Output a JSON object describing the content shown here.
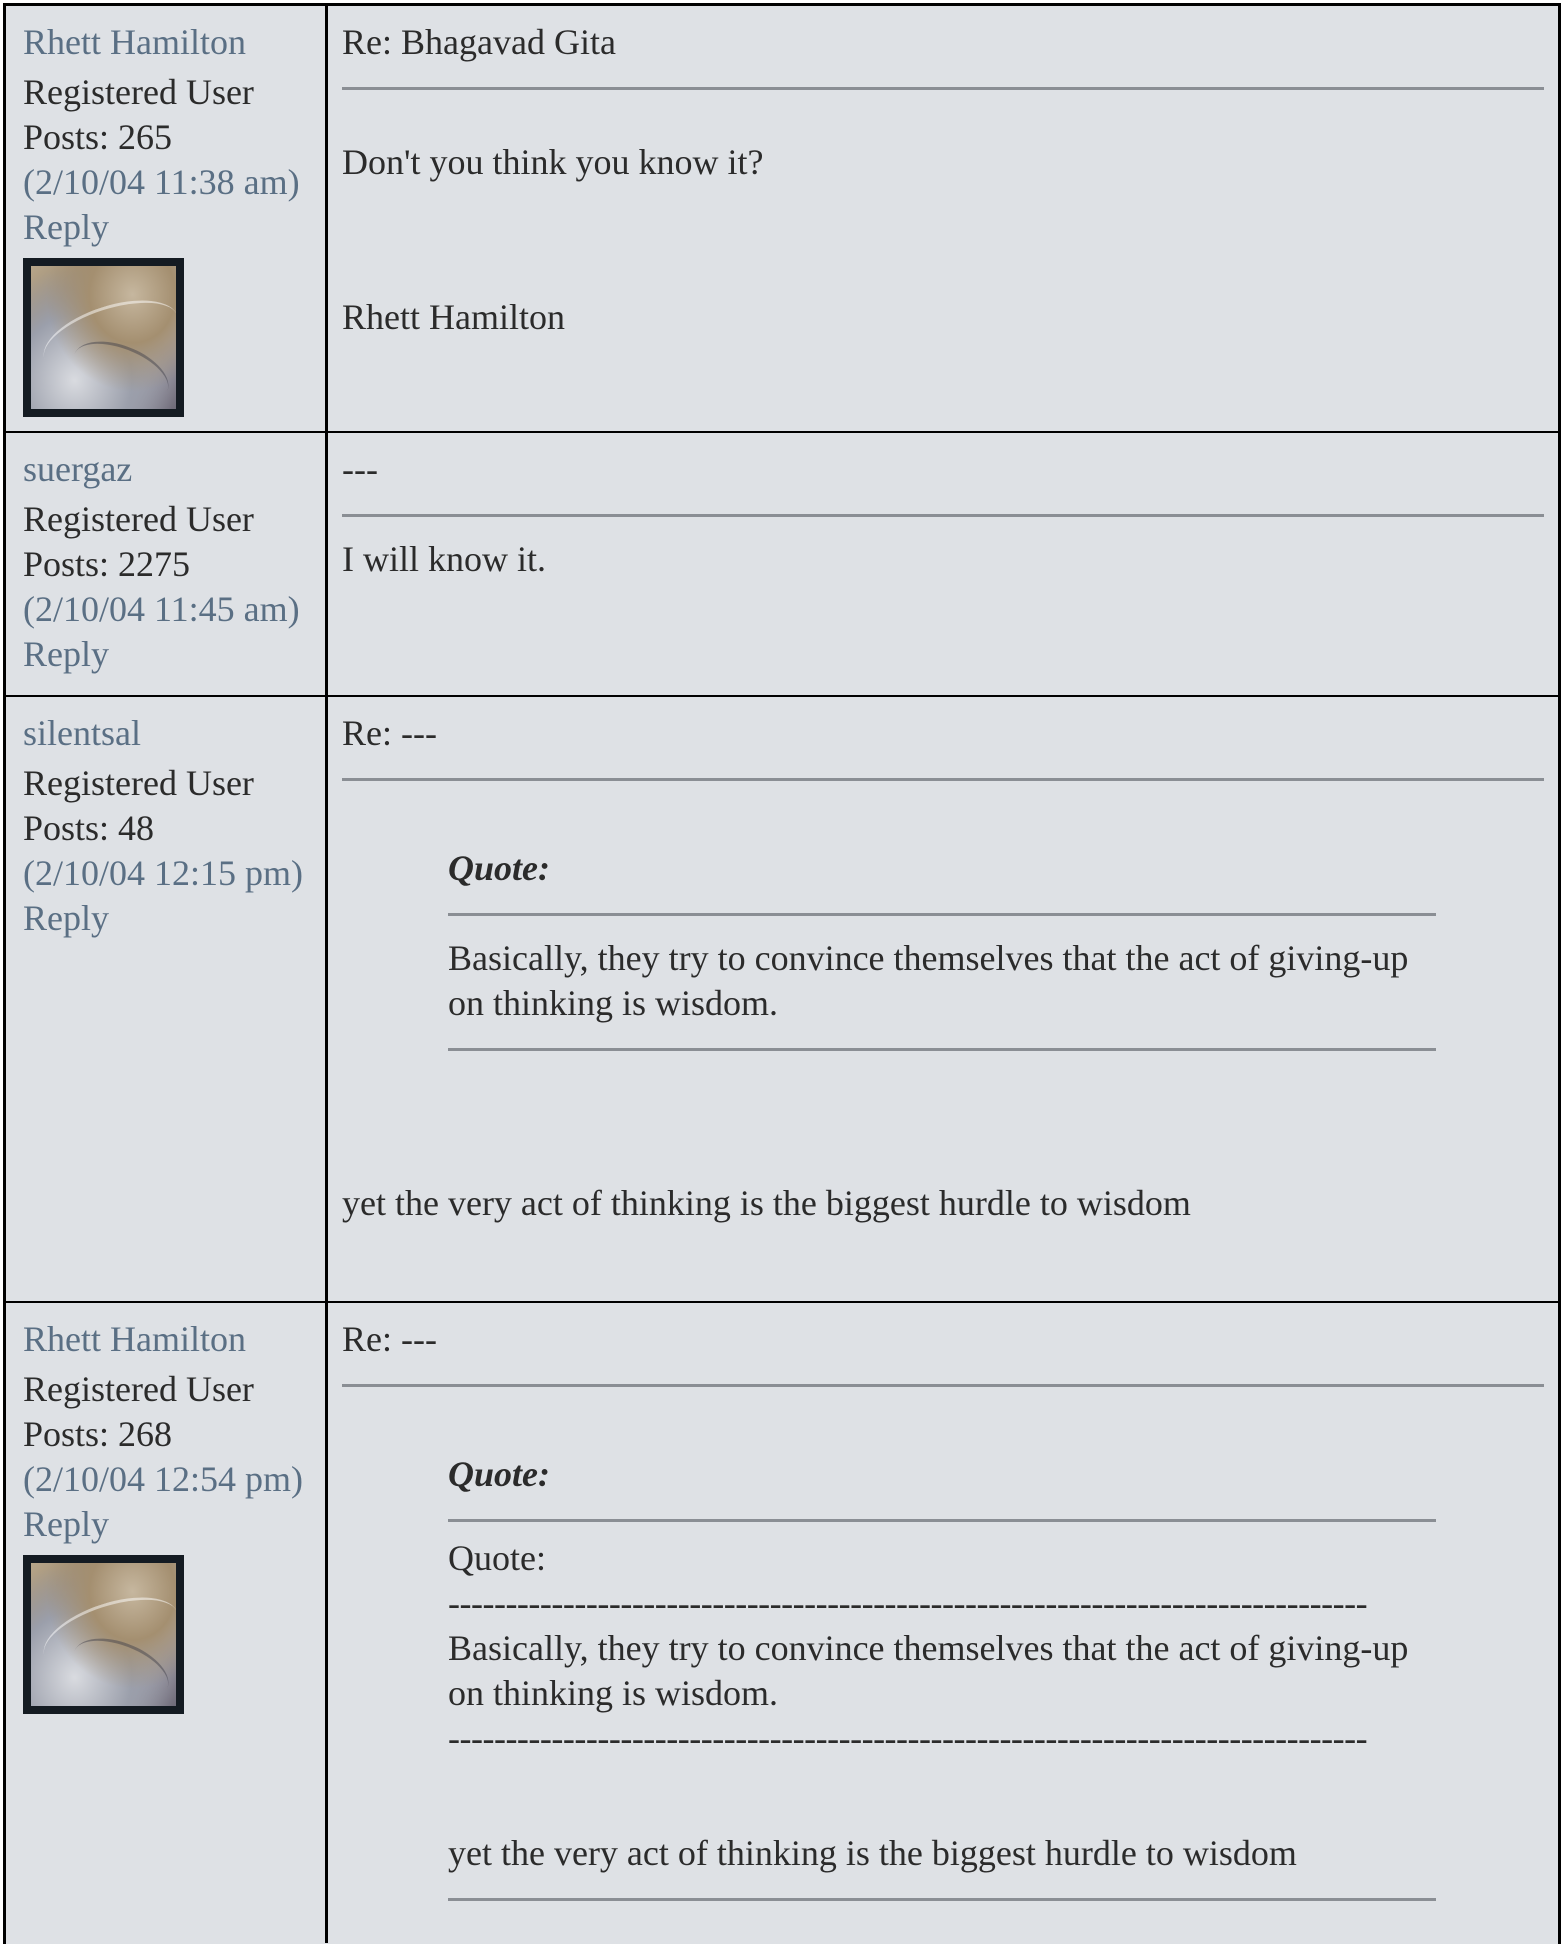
{
  "posts": [
    {
      "author": "Rhett Hamilton",
      "role": "Registered User",
      "posts": "Posts: 265",
      "date": "(2/10/04 11:38 am)",
      "reply": "Reply",
      "has_avatar": true,
      "subject": "Re: Bhagavad Gita",
      "lines": [
        "Don't you think you know it?",
        "Rhett Hamilton"
      ]
    },
    {
      "author": "suergaz",
      "role": "Registered User",
      "posts": "Posts: 2275",
      "date": "(2/10/04 11:45 am)",
      "reply": "Reply",
      "has_avatar": false,
      "subject": "---",
      "lines": [
        "I will know it."
      ]
    },
    {
      "author": "silentsal",
      "role": "Registered User",
      "posts": "Posts: 48",
      "date": "(2/10/04 12:15 pm)",
      "reply": "Reply",
      "has_avatar": false,
      "subject": "Re: ---",
      "quote_label": "Quote:",
      "quote_text": "Basically, they try to convince themselves that the act of giving-up on thinking is wisdom.",
      "after_quote": "yet the very act of thinking is the biggest hurdle to wisdom"
    },
    {
      "author": "Rhett Hamilton",
      "role": "Registered User",
      "posts": "Posts: 268",
      "date": "(2/10/04 12:54 pm)",
      "reply": "Reply",
      "has_avatar": true,
      "subject": "Re: ---",
      "quote_label": "Quote:",
      "inner_quote_label": "Quote:",
      "dash_line": "--------------------------------------------------------------------------------",
      "inner_quote_text": "Basically, they try to convince themselves that the act of giving-up on thinking is wisdom.",
      "inner_after": "yet the very act of thinking is the biggest hurdle to wisdom"
    }
  ]
}
